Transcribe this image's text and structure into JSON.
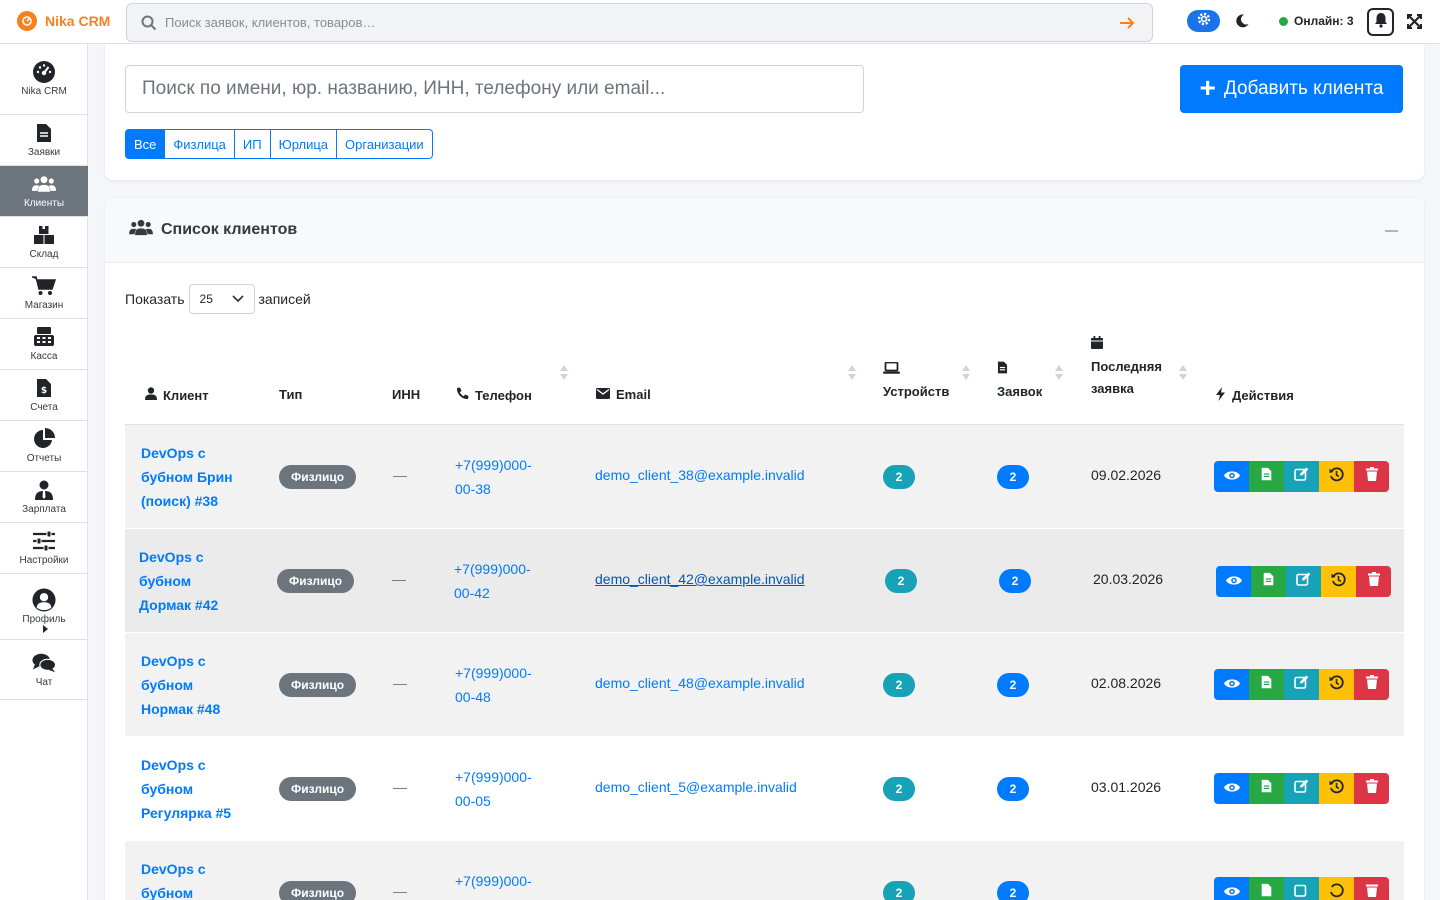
{
  "app": {
    "name": "Nika CRM"
  },
  "global_search": {
    "placeholder": "Поиск заявок, клиентов, товаров…"
  },
  "topbar": {
    "online_label": "Онлайн: 3"
  },
  "sidebar": {
    "items": [
      {
        "label": "Nika CRM",
        "icon": "dashboard-icon"
      },
      {
        "label": "Заявки",
        "icon": "file-icon"
      },
      {
        "label": "Клиенты",
        "icon": "users-icon",
        "active": true
      },
      {
        "label": "Склад",
        "icon": "boxes-icon"
      },
      {
        "label": "Магазин",
        "icon": "cart-icon"
      },
      {
        "label": "Касса",
        "icon": "cash-register-icon"
      },
      {
        "label": "Счета",
        "icon": "invoice-icon"
      },
      {
        "label": "Отчеты",
        "icon": "pie-chart-icon"
      },
      {
        "label": "Зарплата",
        "icon": "user-tie-icon"
      },
      {
        "label": "Настройки",
        "icon": "sliders-icon"
      },
      {
        "label": "Профиль",
        "icon": "user-circle-icon"
      },
      {
        "label": "Чат",
        "icon": "comments-icon"
      }
    ]
  },
  "clients_top": {
    "search_placeholder": "Поиск по имени, юр. названию, ИНН, телефону или email...",
    "add_button": "Добавить клиента",
    "filters": [
      "Все",
      "Физлица",
      "ИП",
      "Юрлица",
      "Организации"
    ],
    "active_filter": "Все"
  },
  "clients_list": {
    "title": "Список клиентов",
    "show_label": "Показать",
    "page_size": "25",
    "records_label": "записей",
    "columns": {
      "client": "Клиент",
      "type": "Тип",
      "inn": "ИНН",
      "phone": "Телефон",
      "email": "Email",
      "devices": "Устройств",
      "requests": "Заявок",
      "last_request_1": "Последняя",
      "last_request_2": "заявка",
      "actions": "Действия"
    },
    "rows": [
      {
        "name_1": "DevOps с",
        "name_2": "бубном Брин",
        "name_3": "(поиск) #38",
        "type": "Физлицо",
        "inn": "—",
        "phone_1": "+7(999)000-",
        "phone_2": "00-38",
        "email": "demo_client_38@example.invalid",
        "devices": "2",
        "requests": "2",
        "last": "09.02.2026"
      },
      {
        "name_1": "DevOps с",
        "name_2": "бубном",
        "name_3": "Дормак #42",
        "type": "Физлицо",
        "inn": "—",
        "phone_1": "+7(999)000-",
        "phone_2": "00-42",
        "email": "demo_client_42@example.invalid",
        "devices": "2",
        "requests": "2",
        "last": "20.03.2026"
      },
      {
        "name_1": "DevOps с",
        "name_2": "бубном",
        "name_3": "Нормак #48",
        "type": "Физлицо",
        "inn": "—",
        "phone_1": "+7(999)000-",
        "phone_2": "00-48",
        "email": "demo_client_48@example.invalid",
        "devices": "2",
        "requests": "2",
        "last": "02.08.2026"
      },
      {
        "name_1": "DevOps с",
        "name_2": "бубном",
        "name_3": "Регулярка #5",
        "type": "Физлицо",
        "inn": "—",
        "phone_1": "+7(999)000-",
        "phone_2": "00-05",
        "email": "demo_client_5@example.invalid",
        "devices": "2",
        "requests": "2",
        "last": "03.01.2026"
      },
      {
        "name_1": "DevOps с",
        "name_2": "бубном",
        "name_3": "",
        "type": "Физлицо",
        "inn": "—",
        "phone_1": "+7(999)000-",
        "phone_2": "",
        "email": "",
        "devices": "2",
        "requests": "2",
        "last": ""
      }
    ]
  },
  "colors": {
    "primary": "#007bff",
    "orange": "#f5821f",
    "teal": "#17a2b8",
    "green": "#28a745",
    "yellow": "#ffc107",
    "red": "#dc3545",
    "gray": "#6c757d"
  }
}
